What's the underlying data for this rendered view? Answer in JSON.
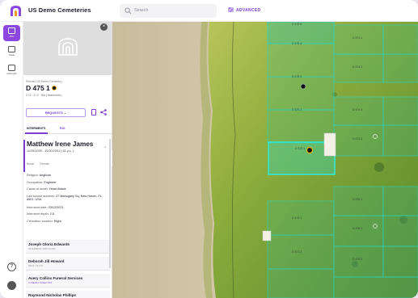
{
  "app": {
    "title": "US Demo Cemeteries"
  },
  "search": {
    "placeholder": "Search"
  },
  "advanced": {
    "label": "ADVANCED"
  },
  "nav": [
    {
      "label": "Plot",
      "active": true
    },
    {
      "label": "Table"
    },
    {
      "label": "Calendar"
    }
  ],
  "panel": {
    "cemetery": "Primary US Demo Cemetery",
    "plot_id": "D 475 1",
    "meta": "2 / 2  ·  2 / 2  ·  N/A  ( Monument )",
    "requests_label": "REQUESTS",
    "tabs": [
      "INTERMENTS",
      "ROI"
    ],
    "person": {
      "name": "Matthew Irene James",
      "dates": "11/29/1939 - 10/30/2001 ( 61 y.o. )",
      "tags": [
        "Burial",
        "Female"
      ]
    },
    "fields": [
      {
        "label": "Religion:",
        "value": "Anglican"
      },
      {
        "label": "Occupation:",
        "value": "Engineer"
      },
      {
        "label": "Cause of death:",
        "value": "Heart Attack"
      },
      {
        "label": "Last known address:",
        "value": "27 Mahogany Sq, New Haven, FL, 6501, USA",
        "wrap": true
      },
      {
        "label": "Interment date:",
        "value": "03/12/2021"
      },
      {
        "label": "Interment depth:",
        "value": "2.5"
      },
      {
        "label": "Cremation location:",
        "value": "Right"
      }
    ],
    "others": [
      {
        "name": "Joseph Gloria Edwards",
        "role": "INTERMENT APPLICANT"
      },
      {
        "name": "Deborah Jill Howard",
        "role": "NEXT OF KIN"
      },
      {
        "name": "Avery Collins Funeral Services",
        "role": "FUNERAL DIRECTOR",
        "accent": true
      },
      {
        "name": "Raymond Nicholas Phillips",
        "role": ""
      }
    ]
  },
  "map": {
    "plot_labels": [
      "D 475 5",
      "D 475 4",
      "D 475 3",
      "D 475 2",
      "D 475 1",
      "D 474 1",
      "D 474 2",
      "D 474 3",
      "D 474 4",
      "D 476 1",
      "D 476 2",
      "D 476 3",
      "D 473 1",
      "D 473 2"
    ]
  },
  "colors": {
    "accent": "#8b47e0",
    "selected_plot": "#34e6d2"
  }
}
